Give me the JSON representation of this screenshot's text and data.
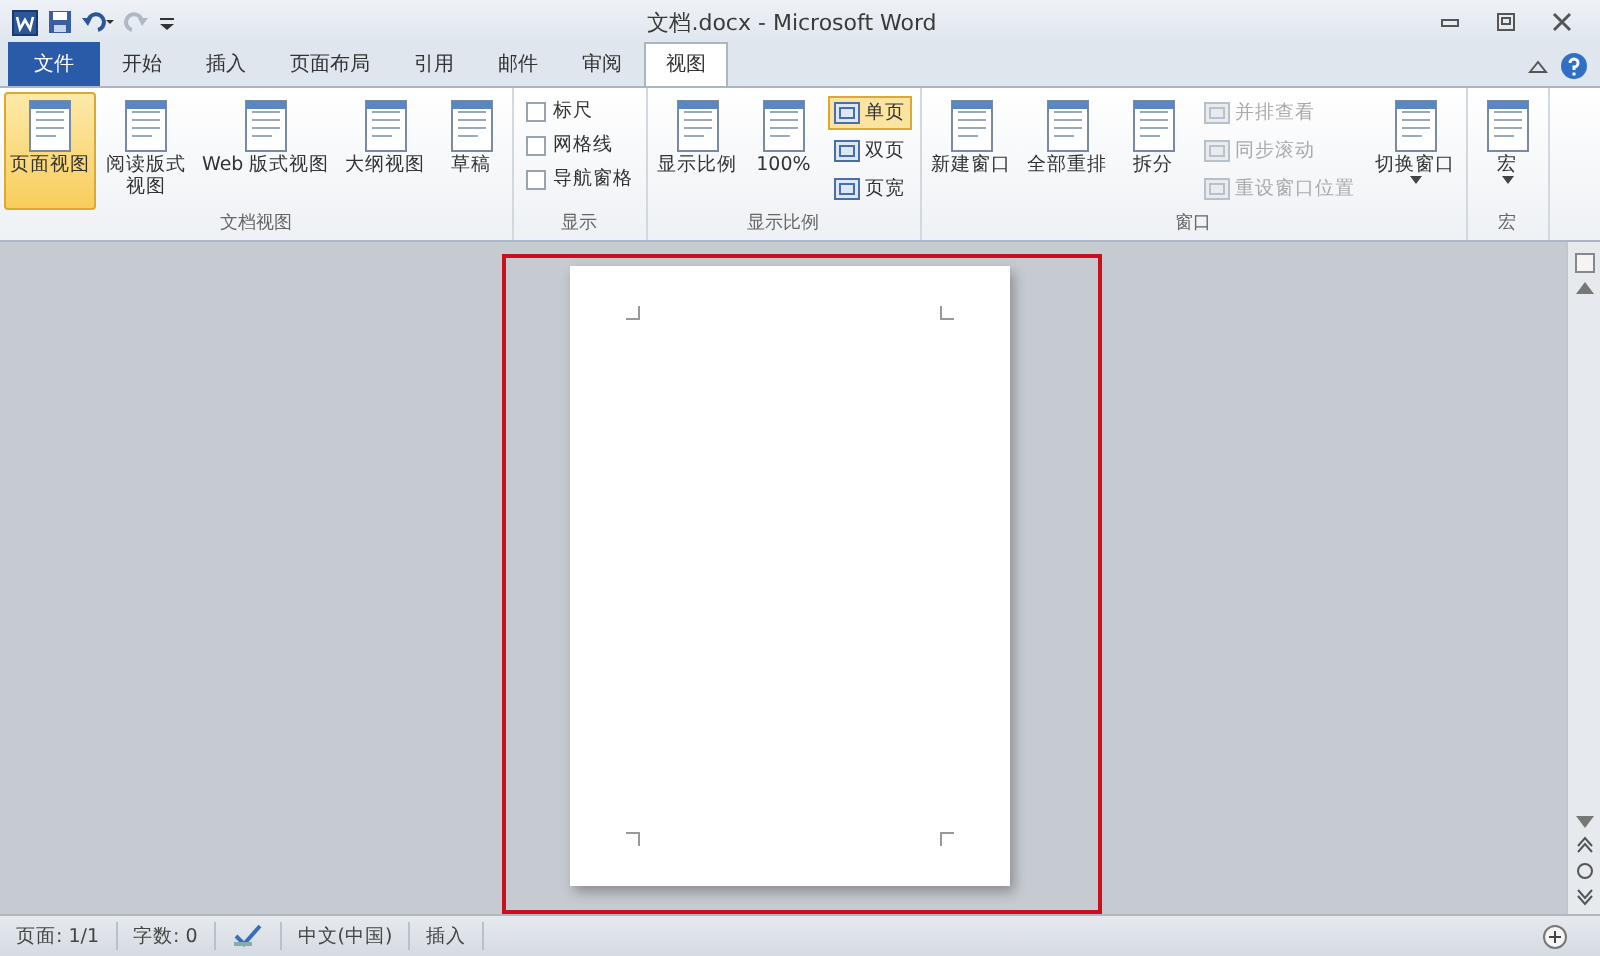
{
  "window": {
    "title": "文档.docx - Microsoft Word"
  },
  "tabs": [
    {
      "label": "文件",
      "kind": "file",
      "selected": false
    },
    {
      "label": "开始",
      "kind": "tab",
      "selected": false
    },
    {
      "label": "插入",
      "kind": "tab",
      "selected": false
    },
    {
      "label": "页面布局",
      "kind": "tab",
      "selected": false
    },
    {
      "label": "引用",
      "kind": "tab",
      "selected": false
    },
    {
      "label": "邮件",
      "kind": "tab",
      "selected": false
    },
    {
      "label": "审阅",
      "kind": "tab",
      "selected": false
    },
    {
      "label": "视图",
      "kind": "tab",
      "selected": true
    }
  ],
  "ribbon": {
    "groups": [
      {
        "name": "文档视图",
        "items": [
          {
            "kind": "large",
            "label": "页面视图",
            "selected": true,
            "disabled": false,
            "dropdown": false
          },
          {
            "kind": "large",
            "label": [
              "阅读版式",
              "视图"
            ],
            "selected": false,
            "disabled": false,
            "dropdown": false
          },
          {
            "kind": "large",
            "label": "Web 版式视图",
            "selected": false,
            "disabled": false,
            "dropdown": false
          },
          {
            "kind": "large",
            "label": "大纲视图",
            "selected": false,
            "disabled": false,
            "dropdown": false
          },
          {
            "kind": "large",
            "label": "草稿",
            "selected": false,
            "disabled": false,
            "dropdown": false
          }
        ]
      },
      {
        "name": "显示",
        "items": [
          {
            "kind": "check",
            "label": "标尺",
            "checked": false
          },
          {
            "kind": "check",
            "label": "网格线",
            "checked": false
          },
          {
            "kind": "check",
            "label": "导航窗格",
            "checked": false
          }
        ]
      },
      {
        "name": "显示比例",
        "items": [
          {
            "kind": "large",
            "label": "显示比例",
            "selected": false,
            "disabled": false,
            "dropdown": false
          },
          {
            "kind": "large",
            "label": "100%",
            "selected": false,
            "disabled": false,
            "dropdown": false
          },
          {
            "kind": "small",
            "label": "单页",
            "selected": true,
            "disabled": false
          },
          {
            "kind": "small",
            "label": "双页",
            "selected": false,
            "disabled": false
          },
          {
            "kind": "small",
            "label": "页宽",
            "selected": false,
            "disabled": false
          }
        ]
      },
      {
        "name": "窗口",
        "items": [
          {
            "kind": "large",
            "label": "新建窗口",
            "selected": false,
            "disabled": false,
            "dropdown": false
          },
          {
            "kind": "large",
            "label": "全部重排",
            "selected": false,
            "disabled": false,
            "dropdown": false
          },
          {
            "kind": "large",
            "label": "拆分",
            "selected": false,
            "disabled": false,
            "dropdown": false
          },
          {
            "kind": "small",
            "label": "并排查看",
            "selected": false,
            "disabled": true
          },
          {
            "kind": "small",
            "label": "同步滚动",
            "selected": false,
            "disabled": true
          },
          {
            "kind": "small",
            "label": "重设窗口位置",
            "selected": false,
            "disabled": true
          },
          {
            "kind": "large",
            "label": "切换窗口",
            "selected": false,
            "disabled": false,
            "dropdown": true
          }
        ]
      },
      {
        "name": "宏",
        "items": [
          {
            "kind": "large",
            "label": "宏",
            "selected": false,
            "disabled": false,
            "dropdown": true
          }
        ]
      }
    ]
  },
  "status_bar": {
    "page": "页面: 1/1",
    "words": "字数: 0",
    "language": "中文(中国)",
    "mode": "插入"
  }
}
